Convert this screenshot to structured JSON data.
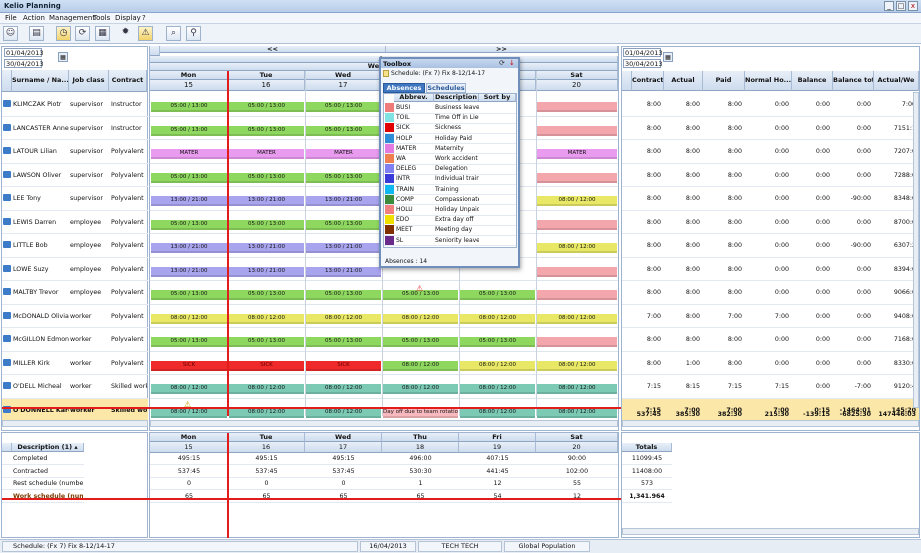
{
  "app": {
    "title": "Kelio Planning"
  },
  "menu": [
    "File",
    "Action",
    "Management",
    "Tools",
    "Display",
    "?"
  ],
  "dates": {
    "left_start": "01/04/2013",
    "left_end": "30/04/2013",
    "right_start": "01/04/2013",
    "right_end": "30/04/2013"
  },
  "nav": {
    "prev": "<<",
    "next": ">>",
    "month": "Ap",
    "week": "Week 16"
  },
  "left_headers": [
    "Surname / Na...",
    "Job class",
    "Contract"
  ],
  "days": [
    {
      "name": "Mon",
      "num": "15"
    },
    {
      "name": "Tue",
      "num": "16"
    },
    {
      "name": "Wed",
      "num": "17"
    },
    {
      "name": "Thu",
      "num": "18"
    },
    {
      "name": "Fri",
      "num": "19"
    },
    {
      "name": "Sat",
      "num": "20"
    }
  ],
  "right_headers": [
    "Contracted",
    "Actual",
    "Paid",
    "Normal Ho...",
    "Balance",
    "Balance tot...",
    "Actual/We"
  ],
  "employees": [
    {
      "name": "KLIMCZAK Piotr",
      "job": "supervisor",
      "contract": "Instructor",
      "vals": [
        "8:00",
        "8:00",
        "8:00",
        "0:00",
        "0:00",
        "0:00",
        "7:00"
      ]
    },
    {
      "name": "LANCASTER Anne",
      "job": "supervisor",
      "contract": "Instructor",
      "vals": [
        "8:00",
        "8:00",
        "8:00",
        "0:00",
        "0:00",
        "0:00",
        "7151:1"
      ]
    },
    {
      "name": "LATOUR Lilian",
      "job": "supervisor",
      "contract": "Polyvalent",
      "vals": [
        "8:00",
        "8:00",
        "8:00",
        "0:00",
        "0:00",
        "0:00",
        "7207:0"
      ]
    },
    {
      "name": "LAWSON Oliver",
      "job": "supervisor",
      "contract": "Polyvalent",
      "vals": [
        "8:00",
        "8:00",
        "8:00",
        "0:00",
        "0:00",
        "0:00",
        "7288:0"
      ]
    },
    {
      "name": "LEE Tony",
      "job": "supervisor",
      "contract": "Polyvalent",
      "vals": [
        "8:00",
        "8:00",
        "8:00",
        "0:00",
        "0:00",
        "-90:00",
        "8348:0"
      ]
    },
    {
      "name": "LEWIS Darren",
      "job": "employee",
      "contract": "Polyvalent",
      "vals": [
        "8:00",
        "8:00",
        "8:00",
        "0:00",
        "0:00",
        "0:00",
        "8700:0"
      ]
    },
    {
      "name": "LITTLE Bob",
      "job": "employee",
      "contract": "Polyvalent",
      "vals": [
        "8:00",
        "8:00",
        "8:00",
        "0:00",
        "0:00",
        "-90:00",
        "6307:2"
      ]
    },
    {
      "name": "LOWE Suzy",
      "job": "employee",
      "contract": "Polyvalent",
      "vals": [
        "8:00",
        "8:00",
        "8:00",
        "0:00",
        "0:00",
        "0:00",
        "8394:0"
      ]
    },
    {
      "name": "MALTBY Trevor",
      "job": "employee",
      "contract": "Polyvalent",
      "vals": [
        "8:00",
        "8:00",
        "8:00",
        "0:00",
        "0:00",
        "0:00",
        "9066:0"
      ]
    },
    {
      "name": "McDONALD Olivia",
      "job": "worker",
      "contract": "Polyvalent",
      "vals": [
        "7:00",
        "8:00",
        "7:00",
        "7:00",
        "0:00",
        "0:00",
        "9408:0"
      ]
    },
    {
      "name": "McGILLON Edmond",
      "job": "worker",
      "contract": "Polyvalent",
      "vals": [
        "8:00",
        "8:00",
        "8:00",
        "0:00",
        "0:00",
        "0:00",
        "7168:0"
      ]
    },
    {
      "name": "MILLER Kirk",
      "job": "worker",
      "contract": "Polyvalent",
      "vals": [
        "8:00",
        "1:00",
        "8:00",
        "0:00",
        "0:00",
        "0:00",
        "8330:0"
      ]
    },
    {
      "name": "O'DELL Micheal",
      "job": "worker",
      "contract": "Skilled worker",
      "vals": [
        "7:15",
        "8:15",
        "7:15",
        "7:15",
        "0:00",
        "-7:00",
        "9120:4"
      ]
    },
    {
      "name": "O'DONNELL Karen",
      "job": "worker",
      "contract": "Skilled worl",
      "vals": [
        "7:15",
        "7:00",
        "7:00",
        "7:00",
        "0:15",
        "-1464:01",
        "145:20"
      ]
    }
  ],
  "totals_row": [
    "537:45",
    "385:30",
    "382:30",
    "215:30",
    "-139:15",
    "-6825:30",
    "147446:03"
  ],
  "shifts": {
    "morning": "05:00 / 13:00",
    "afternoon": "13:00 / 21:00",
    "day": "08:00 / 12:00",
    "mater": "MATER",
    "sick": "SICK",
    "dayoff": "Day off due to team rotation"
  },
  "toolbox": {
    "title": "Toolbox",
    "schedule": "Schedule: (Fx 7) Fix  8-12/14-17",
    "tabs": [
      "Absences",
      "Schedules"
    ],
    "cols": [
      "Abbrev.",
      "Description",
      "Sort by"
    ],
    "items": [
      {
        "code": "BUSI",
        "desc": "Business leave",
        "color": "#f07b7b"
      },
      {
        "code": "TOIL",
        "desc": "Time Off in Lieu",
        "color": "#7fe3e3"
      },
      {
        "code": "SICK",
        "desc": "Sickness",
        "color": "#e00000"
      },
      {
        "code": "HOLP",
        "desc": "Holiday Paid",
        "color": "#2f8cd6"
      },
      {
        "code": "MATER",
        "desc": "Maternity",
        "color": "#e27ae0"
      },
      {
        "code": "WA",
        "desc": "Work accident",
        "color": "#f08050"
      },
      {
        "code": "DELEG",
        "desc": "Delegation",
        "color": "#8080f0"
      },
      {
        "code": "INTR",
        "desc": "Individual traini",
        "color": "#3a3ad8"
      },
      {
        "code": "TRAIN",
        "desc": "Training",
        "color": "#10b8f0"
      },
      {
        "code": "COMP",
        "desc": "Compassionate",
        "color": "#3c8a3c"
      },
      {
        "code": "HOLU",
        "desc": "Holiday Unpaid",
        "color": "#f08080"
      },
      {
        "code": "EDO",
        "desc": "Extra day off",
        "color": "#f0e000"
      },
      {
        "code": "MEET",
        "desc": "Meeting day",
        "color": "#803000"
      },
      {
        "code": "SL",
        "desc": "Seniority leave",
        "color": "#6a2a8a"
      }
    ],
    "count": "Absences : 14"
  },
  "summary": {
    "header": "Description (1)",
    "rows": [
      "Completed",
      "Contracted",
      "Rest schedule (number)",
      "Work schedule (numbe"
    ],
    "values": [
      [
        "495:15",
        "495:15",
        "495:15",
        "496:00",
        "407:15",
        "90:00"
      ],
      [
        "537:45",
        "537:45",
        "537:45",
        "530:30",
        "441:45",
        "102:00"
      ],
      [
        "0",
        "0",
        "0",
        "1",
        "12",
        "55"
      ],
      [
        "65",
        "65",
        "65",
        "65",
        "54",
        "12"
      ]
    ],
    "totals_header": "Totals",
    "totals": [
      "11099:45",
      "11408:00",
      "573",
      "1,341.964"
    ]
  },
  "status": {
    "schedule": "Schedule: (Fx 7) Fix  8-12/14-17",
    "date": "16/04/2013",
    "user": "TECH TECH",
    "population": "Global Population"
  }
}
